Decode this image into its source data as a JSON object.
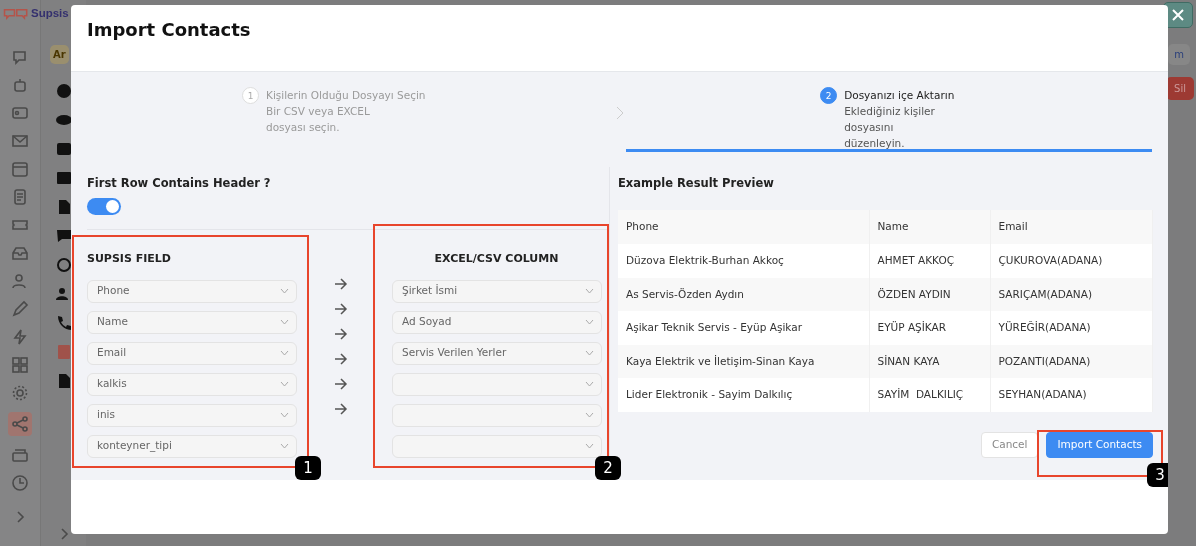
{
  "app": {
    "brand": "Supsis",
    "tab_fragment": "Ar",
    "button_fragment": "m",
    "delete_button": "Sil"
  },
  "modal": {
    "title": "Import Contacts",
    "steps": [
      {
        "number": "1",
        "title": "Kişilerin Olduğu Dosyayı Seçin",
        "description": "Bir CSV veya EXCEL\ndosyası seçin.",
        "selected": false
      },
      {
        "number": "2",
        "title": "Dosyanızı içe Aktarın",
        "description": "Eklediğiniz kişiler\ndosyasını\ndüzenleyin.",
        "selected": true
      }
    ],
    "header_toggle": {
      "label": "First Row Contains Header ?",
      "on": true
    },
    "fields_heading": "SUPSIS FIELD",
    "columns_heading": "EXCEL/CSV COLUMN",
    "mappings": [
      {
        "field": "Phone",
        "column": "Şirket İsmi"
      },
      {
        "field": "Name",
        "column": "Ad Soyad"
      },
      {
        "field": "Email",
        "column": "Servis Verilen Yerler"
      },
      {
        "field": "kalkis"
      },
      {
        "field": "inis"
      },
      {
        "field": "konteyner_tipi"
      }
    ],
    "preview": {
      "title": "Example Result Preview",
      "columns": [
        "Phone",
        "Name",
        "Email"
      ],
      "rows": [
        [
          "Düzova Elektrik-Burhan Akkoç",
          "AHMET AKKOÇ",
          "ÇUKUROVA(ADANA)"
        ],
        [
          "As Servis-Özden Aydın",
          "ÖZDEN AYDIN",
          "SARIÇAM(ADANA)"
        ],
        [
          "Aşikar Teknik Servis - Eyüp Aşikar",
          "EYÜP AŞİKAR",
          "YÜREĞİR(ADANA)"
        ],
        [
          "Kaya Elektrik ve İletişim-Sinan Kaya",
          "SİNAN KAYA",
          "POZANTI(ADANA)"
        ],
        [
          "Lider Elektronik - Sayim Dalkılıç",
          "SAYİM  DALKILIÇ",
          "SEYHAN(ADANA)"
        ]
      ]
    },
    "buttons": [
      {
        "label": "Cancel",
        "kind": "secondary"
      },
      {
        "label": "Import Contacts",
        "kind": "primary"
      }
    ],
    "callouts": [
      "1",
      "2",
      "3"
    ]
  }
}
